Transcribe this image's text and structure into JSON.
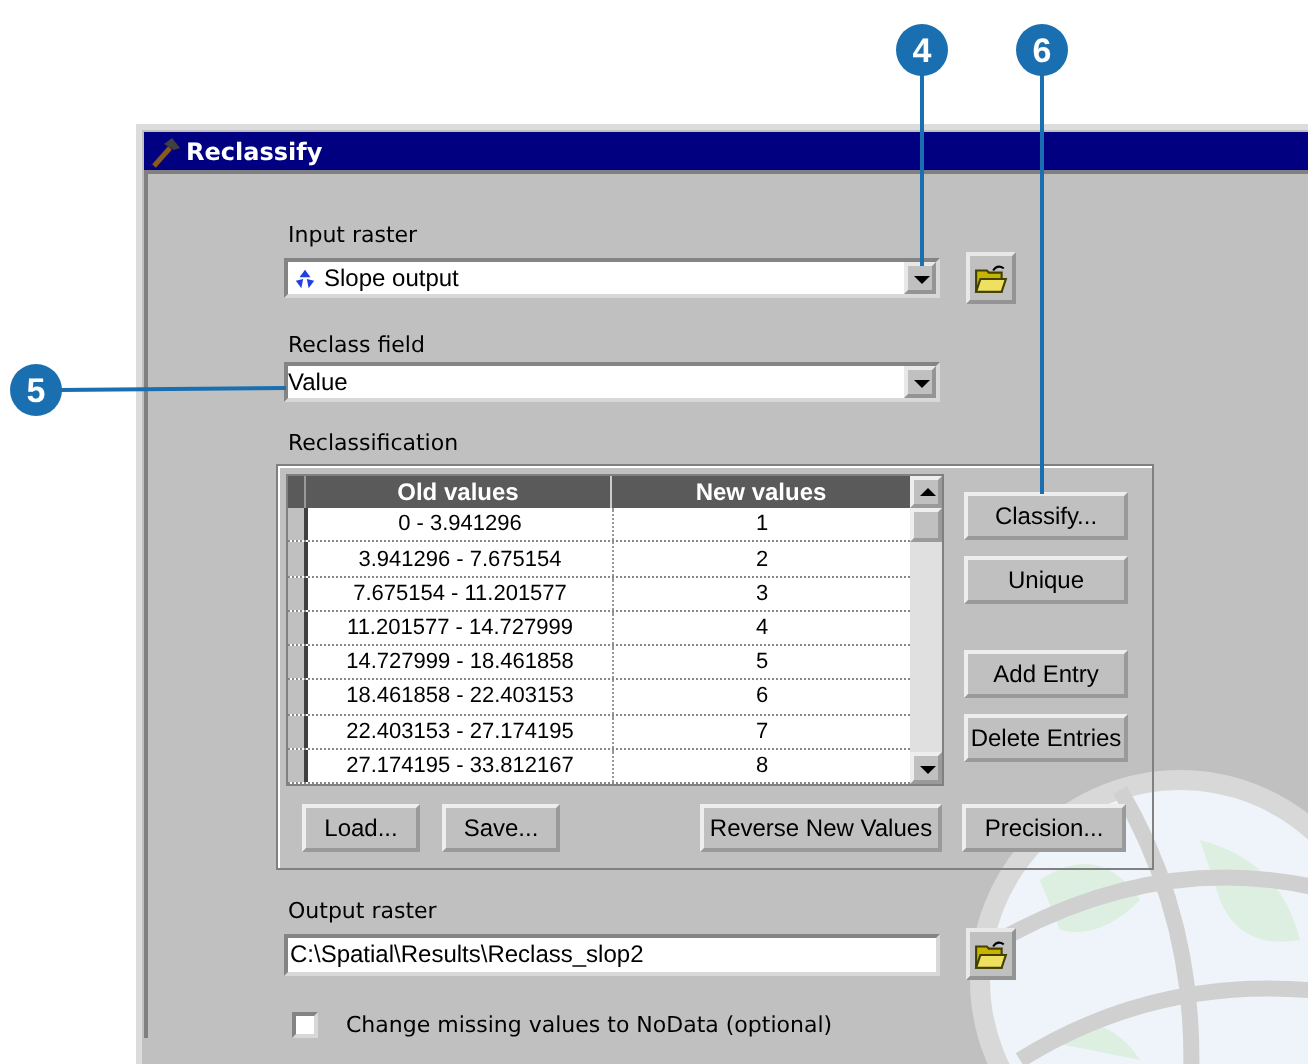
{
  "callouts": [
    {
      "label": "4"
    },
    {
      "label": "6"
    },
    {
      "label": "5"
    }
  ],
  "window": {
    "title": "Reclassify"
  },
  "input_raster": {
    "label": "Input raster",
    "value": "Slope output"
  },
  "reclass_field": {
    "label": "Reclass field",
    "value": "Value"
  },
  "reclassification": {
    "label": "Reclassification",
    "table": {
      "columns": [
        "Old values",
        "New values"
      ],
      "rows": [
        [
          "0 - 3.941296",
          "1"
        ],
        [
          "3.941296 - 7.675154",
          "2"
        ],
        [
          "7.675154 - 11.201577",
          "3"
        ],
        [
          "11.201577 - 14.727999",
          "4"
        ],
        [
          "14.727999 - 18.461858",
          "5"
        ],
        [
          "18.461858 - 22.403153",
          "6"
        ],
        [
          "22.403153 - 27.174195",
          "7"
        ],
        [
          "27.174195 - 33.812167",
          "8"
        ]
      ]
    },
    "side_buttons": [
      "Classify...",
      "Unique",
      "Add Entry",
      "Delete Entries"
    ],
    "bottom_buttons": [
      "Load...",
      "Save...",
      "Reverse New Values",
      "Precision..."
    ]
  },
  "output_raster": {
    "label": "Output raster",
    "value": "C:\\Spatial\\Results\\Reclass_slop2"
  },
  "missing_values": {
    "label": "Change missing values to NoData (optional)",
    "checked": false
  }
}
